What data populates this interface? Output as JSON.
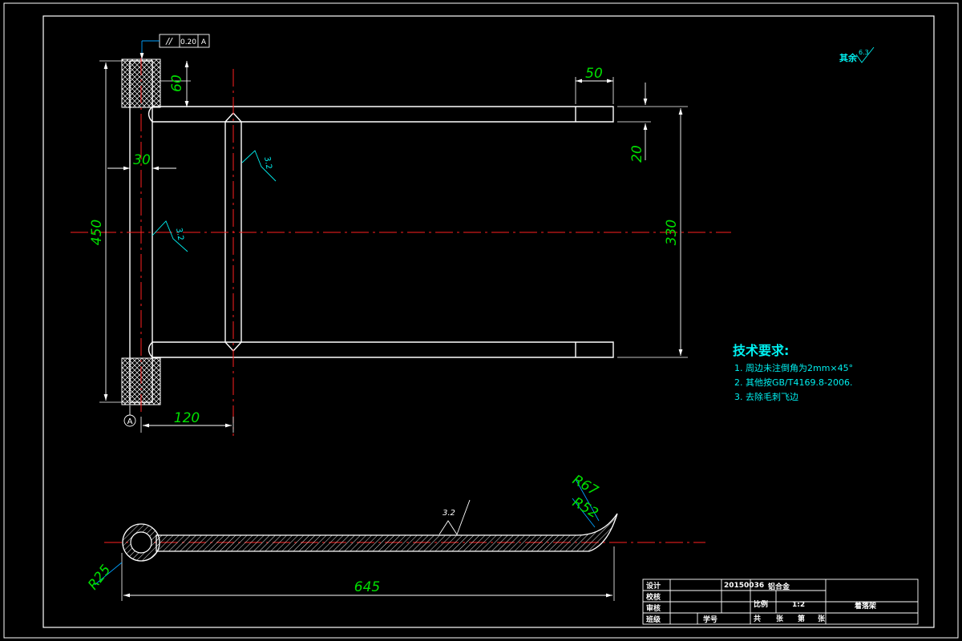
{
  "dimensions": {
    "d60": "60",
    "d50": "50",
    "d30": "30",
    "d20": "20",
    "d450": "450",
    "d330": "330",
    "d120": "120",
    "d645": "645",
    "r25": "R25",
    "r67": "R67",
    "r52": "R52"
  },
  "tolerance": {
    "symbol": "//",
    "value": "0.20",
    "datum": "A"
  },
  "datum_label": "A",
  "roughness": {
    "general_label": "其余",
    "general_value": "6.3",
    "surface_value": "3.2"
  },
  "tech_requirements": {
    "title": "技术要求:",
    "items": [
      "1. 周边未注倒角为2mm×45°",
      "2. 其他按GB/T4169.8-2006.",
      "3. 去除毛刺飞边"
    ]
  },
  "title_block": {
    "design": "设计",
    "check": "校核",
    "review": "审核",
    "class": "班级",
    "student_no_label": "学号",
    "student_no": "20150036",
    "material": "铝合金",
    "scale_label": "比例",
    "scale": "1:2",
    "part_name": "着落架",
    "total": "共",
    "sheets": "张",
    "page": "第",
    "sheet": "张"
  },
  "colors": {
    "background": "#000000",
    "outline": "#ffffff",
    "dimension": "#00e000",
    "centerline": "#ff2020",
    "annotation": "#00f0f0",
    "leader": "#00a0ff"
  }
}
